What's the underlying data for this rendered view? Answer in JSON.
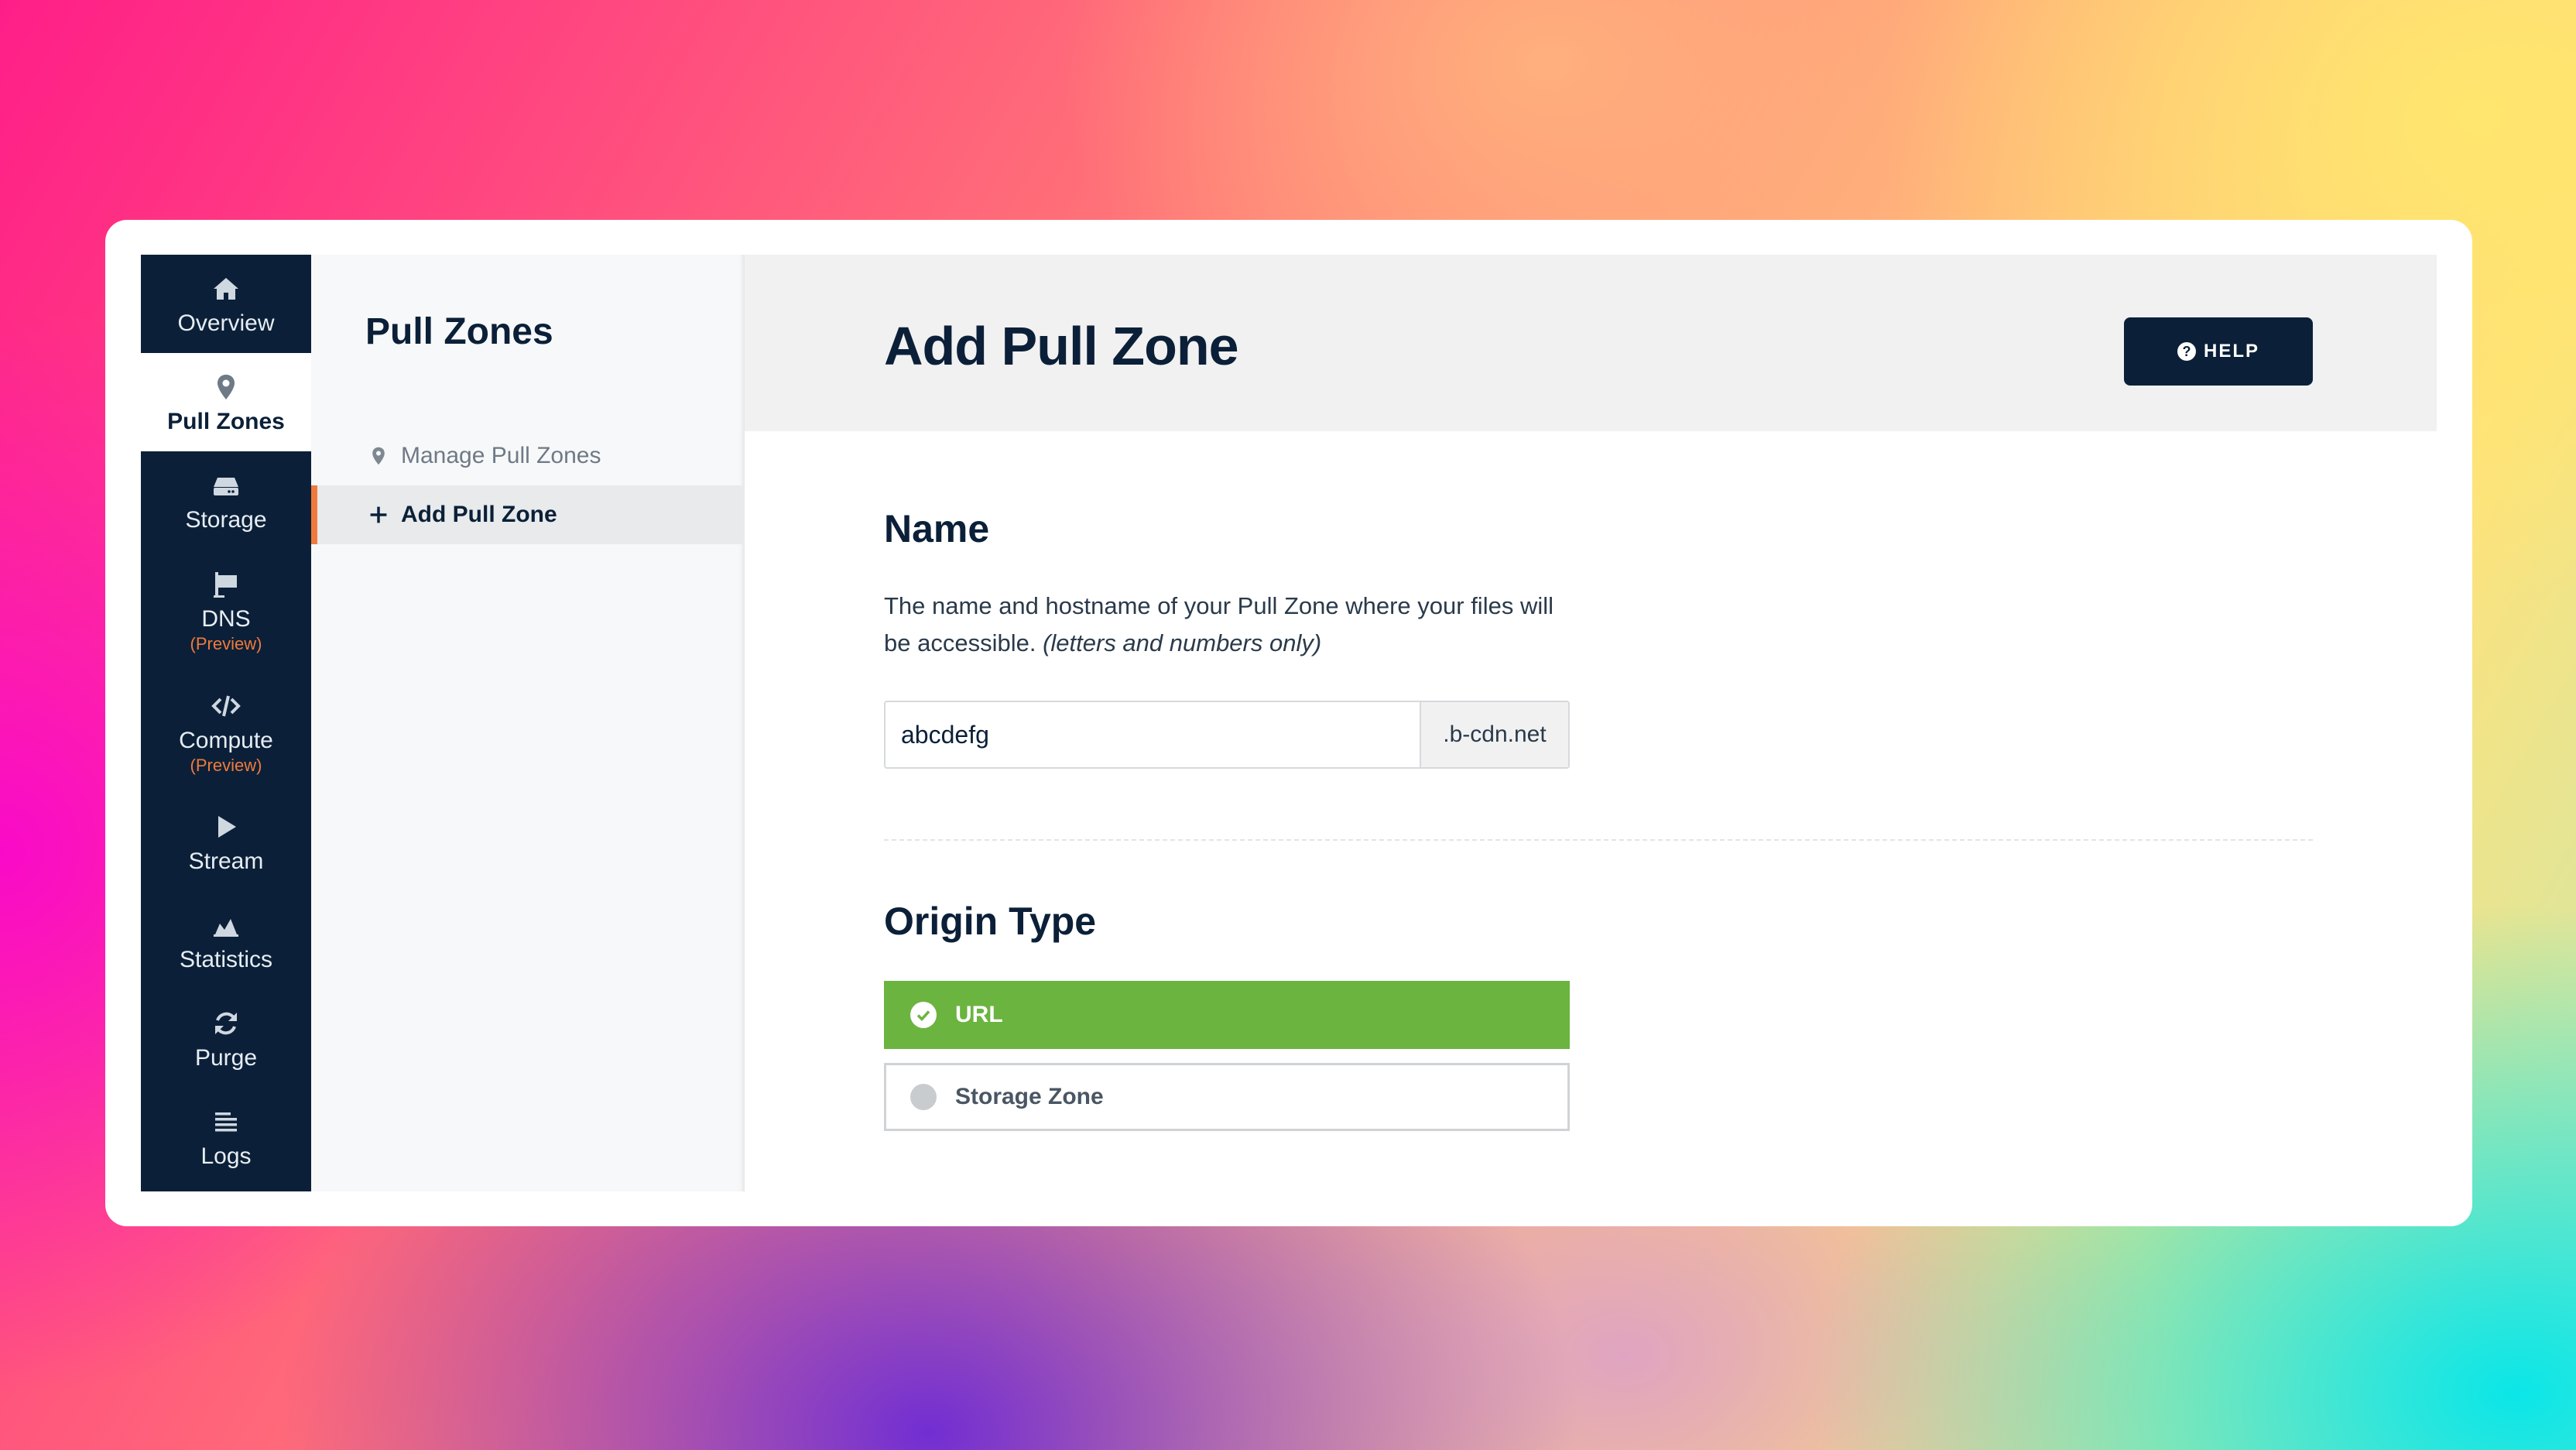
{
  "nav": {
    "items": [
      {
        "label": "Overview",
        "icon": "home-icon"
      },
      {
        "label": "Pull Zones",
        "icon": "location-pin-icon",
        "active": true
      },
      {
        "label": "Storage",
        "icon": "hard-drive-icon"
      },
      {
        "label": "DNS",
        "sub": "(Preview)",
        "icon": "dns-flag-icon"
      },
      {
        "label": "Compute",
        "sub": "(Preview)",
        "icon": "code-icon"
      },
      {
        "label": "Stream",
        "icon": "play-icon"
      },
      {
        "label": "Statistics",
        "icon": "area-chart-icon"
      },
      {
        "label": "Purge",
        "icon": "refresh-icon"
      },
      {
        "label": "Logs",
        "icon": "lines-icon"
      }
    ]
  },
  "submenu": {
    "title": "Pull Zones",
    "items": [
      {
        "label": "Manage Pull Zones",
        "icon": "location-pin-icon"
      },
      {
        "label": "Add Pull Zone",
        "icon": "plus-icon",
        "active": true
      }
    ]
  },
  "header": {
    "title": "Add Pull Zone",
    "help_label": "HELP",
    "help_icon": "question-circle-icon"
  },
  "name_section": {
    "title": "Name",
    "description": "The name and hostname of your Pull Zone where your files will be accessible.",
    "description_hint": "(letters and numbers only)",
    "value": "abcdefg",
    "suffix": ".b-cdn.net"
  },
  "origin_section": {
    "title": "Origin Type",
    "options": [
      {
        "label": "URL",
        "selected": true
      },
      {
        "label": "Storage Zone",
        "selected": false
      }
    ]
  },
  "colors": {
    "navy": "#0b2038",
    "accent_orange": "#f07a3c",
    "selected_green": "#6bb43f"
  }
}
